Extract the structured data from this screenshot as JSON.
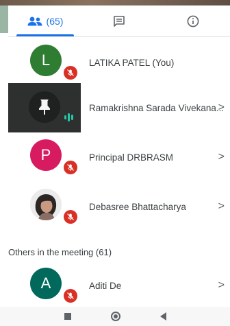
{
  "tabs": {
    "people_count": "(65)",
    "active": "people"
  },
  "participants": [
    {
      "initial": "L",
      "name": "LATIKA PATEL (You)",
      "avatar_color": "#2e7d32",
      "muted": true,
      "chevron": false
    },
    {
      "initial": "",
      "name": "Ramakrishna Sarada Vivekana...",
      "avatar_color": "#2e302f",
      "muted": false,
      "speaking": true,
      "chevron": true
    },
    {
      "initial": "P",
      "name": "Principal DRBRASM",
      "avatar_color": "#d81b60",
      "muted": true,
      "chevron": true
    },
    {
      "initial": "",
      "name": "Debasree Bhattacharya",
      "avatar_color": "#e8e8e8",
      "muted": true,
      "chevron": true
    }
  ],
  "others_section": {
    "label": "Others in the meeting (61)"
  },
  "others": [
    {
      "initial": "A",
      "name": "Aditi De",
      "avatar_color": "#00695c",
      "muted": true,
      "chevron": true
    }
  ],
  "chevron_glyph": ">",
  "colors": {
    "accent": "#1a73e8",
    "muted_badge": "#d93025",
    "speaking": "#26c6a8"
  }
}
